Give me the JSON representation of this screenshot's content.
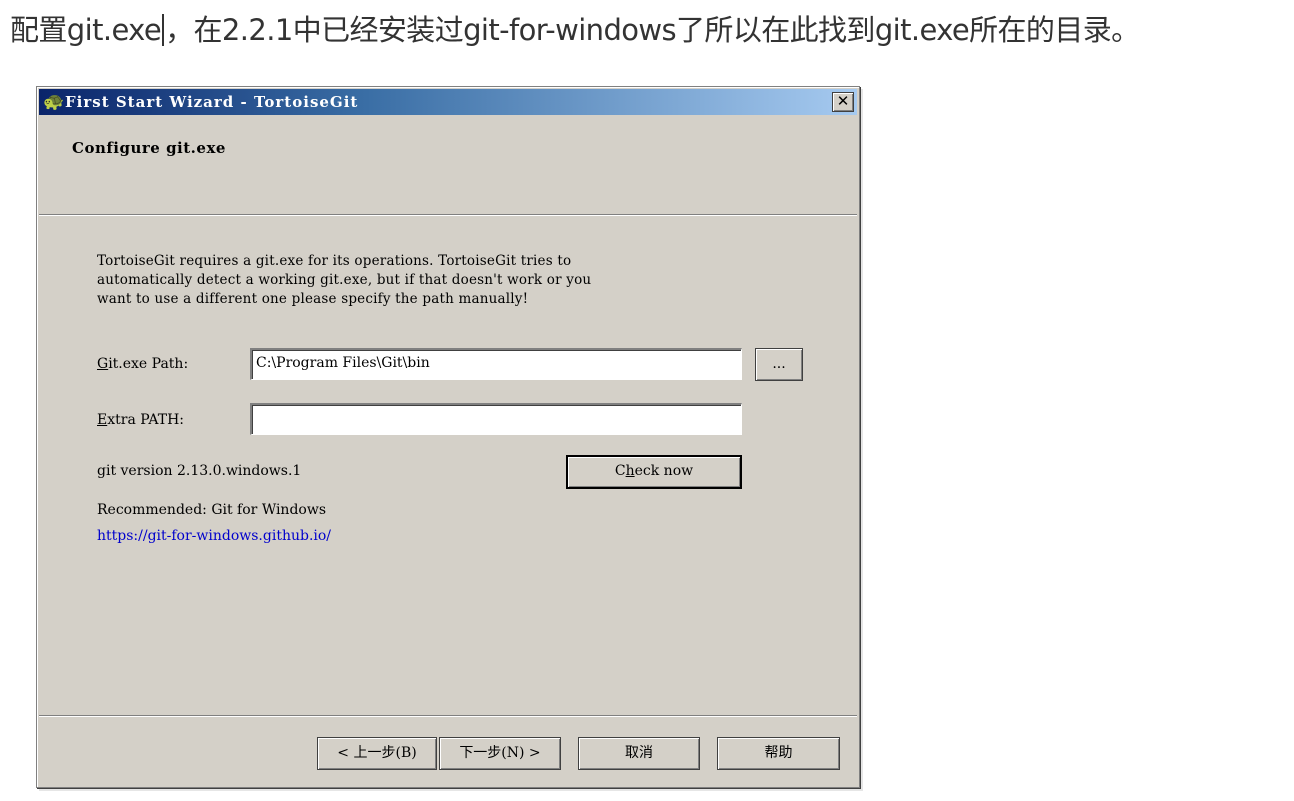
{
  "instruction": {
    "before_caret": "配置git.exe",
    "after_caret": "，在2.2.1中已经安装过git-for-windows了所以在此找到git.exe所在的目录。"
  },
  "dialog": {
    "title": "First Start Wizard - TortoiseGit",
    "close_label": "✕",
    "app_icon": "tortoise-icon",
    "header_title": "Configure git.exe",
    "description": "TortoiseGit requires a git.exe for its operations. TortoiseGit tries to\nautomatically detect a working git.exe, but if that doesn't work or you\nwant to use a different one please specify the path manually!",
    "git_path": {
      "label_mnemonic": "G",
      "label_rest": "it.exe Path:",
      "value": "C:\\Program Files\\Git\\bin",
      "browse_label": "..."
    },
    "extra_path": {
      "label_mnemonic": "E",
      "label_rest": "xtra PATH:",
      "value": ""
    },
    "git_version": "git version 2.13.0.windows.1",
    "check_now": {
      "before": "C",
      "mnemonic": "h",
      "after": "eck now"
    },
    "recommended": "Recommended: Git for Windows",
    "recommended_url": "https://git-for-windows.github.io/",
    "buttons": {
      "back": "< 上一步(B)",
      "next": "下一步(N) >",
      "cancel": "取消",
      "help": "帮助"
    }
  }
}
